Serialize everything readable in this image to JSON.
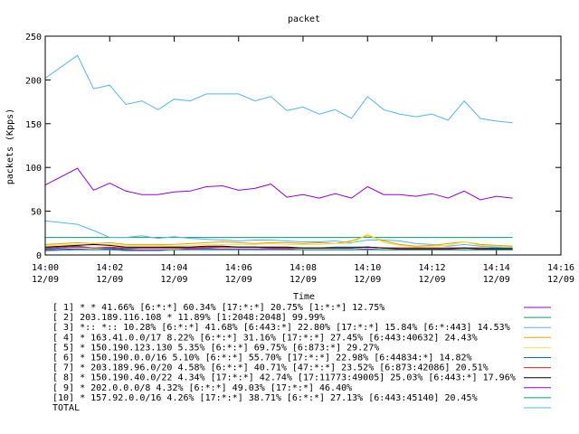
{
  "chart_data": {
    "type": "line",
    "title": "packet",
    "xlabel": "Time",
    "ylabel": "packets (Kpps)",
    "ylim": [
      0,
      250
    ],
    "xlim": [
      0,
      16
    ],
    "yticks": [
      0,
      50,
      100,
      150,
      200,
      250
    ],
    "xticks": [
      {
        "x": 0,
        "time": "14:00",
        "date": "12/09"
      },
      {
        "x": 2,
        "time": "14:02",
        "date": "12/09"
      },
      {
        "x": 4,
        "time": "14:04",
        "date": "12/09"
      },
      {
        "x": 6,
        "time": "14:06",
        "date": "12/09"
      },
      {
        "x": 8,
        "time": "14:08",
        "date": "12/09"
      },
      {
        "x": 10,
        "time": "14:10",
        "date": "12/09"
      },
      {
        "x": 12,
        "time": "14:12",
        "date": "12/09"
      },
      {
        "x": 14,
        "time": "14:14",
        "date": "12/09"
      },
      {
        "x": 16,
        "time": "14:16",
        "date": "12/09"
      }
    ],
    "grid": false,
    "legend": "bottom",
    "x": [
      0,
      1,
      1.5,
      2,
      2.5,
      3,
      3.5,
      4,
      4.5,
      5,
      5.5,
      6,
      6.5,
      7,
      7.5,
      8,
      8.5,
      9,
      9.5,
      10,
      10.5,
      11,
      11.5,
      12,
      12.5,
      13,
      13.5,
      14,
      14.5
    ],
    "series": [
      {
        "name": "[ 1] * * 41.66%  [6:*:*] 60.34% [17:*:*] 20.75% [1:*:*] 12.75%",
        "color": "#9400d3",
        "values": [
          80,
          99,
          74,
          82,
          73,
          69,
          69,
          72,
          73,
          78,
          79,
          74,
          76,
          81,
          66,
          69,
          65,
          70,
          65,
          78,
          69,
          69,
          67,
          70,
          65,
          73,
          63,
          67,
          65
        ]
      },
      {
        "name": "[ 2] 203.189.116.108 * 11.89%  [1:2048:2048] 99.99%",
        "color": "#009e73",
        "values": [
          20,
          20,
          20,
          20,
          20,
          20,
          20,
          20,
          20,
          20,
          20,
          20,
          20,
          20,
          20,
          20,
          20,
          20,
          20,
          20,
          20,
          20,
          20,
          20,
          20,
          20,
          20,
          20,
          20
        ]
      },
      {
        "name": "[ 3] *:: *:: 10.28%  [6:*:*] 41.68% [6:443:*] 22.80% [17:*:*] 15.84% [6:*:443] 14.53%",
        "color": "#56b4e9",
        "values": [
          39,
          35,
          28,
          20,
          20,
          22,
          19,
          21,
          19,
          18,
          17,
          16,
          17,
          17,
          16,
          15,
          15,
          16,
          14,
          17,
          17,
          16,
          13,
          12,
          10,
          12,
          10,
          9,
          10
        ]
      },
      {
        "name": "[ 4] * 163.41.0.0/17 8.22%  [6:*:*] 31.16% [17:*:*] 27.45% [6:443:40632] 24.43%",
        "color": "#e69f00",
        "values": [
          12,
          14,
          13,
          14,
          12,
          12,
          12,
          12,
          13,
          14,
          15,
          14,
          13,
          14,
          14,
          13,
          14,
          13,
          16,
          22,
          16,
          12,
          10,
          11,
          13,
          15,
          12,
          11,
          10
        ]
      },
      {
        "name": "[ 5] * 150.190.123.130 5.35%  [6:*:*] 69.75% [6:873:*] 29.27%",
        "color": "#f0e442",
        "values": [
          11,
          12,
          11,
          12,
          11,
          11,
          11,
          10,
          11,
          12,
          12,
          12,
          12,
          13,
          12,
          12,
          12,
          13,
          13,
          24,
          14,
          11,
          9,
          10,
          11,
          15,
          11,
          10,
          9
        ]
      },
      {
        "name": "[ 6] * 150.190.0.0/16 5.10%  [6:*:*] 55.70% [17:*:*] 22.98% [6:44834:*] 14.82%",
        "color": "#0072b2",
        "values": [
          7,
          9,
          8,
          8,
          7,
          8,
          8,
          8,
          8,
          8,
          9,
          9,
          9,
          8,
          8,
          8,
          8,
          9,
          9,
          9,
          8,
          8,
          8,
          8,
          8,
          8,
          8,
          8,
          8
        ]
      },
      {
        "name": "[ 7] * 203.189.96.0/20 4.58%  [6:*:*] 40.71% [47:*:*] 23.52% [6:873:42086] 20.51%",
        "color": "#e51e10",
        "values": [
          8,
          10,
          8,
          9,
          8,
          8,
          8,
          8,
          8,
          9,
          9,
          9,
          9,
          8,
          8,
          8,
          8,
          8,
          8,
          9,
          8,
          8,
          8,
          8,
          8,
          8,
          8,
          7,
          7
        ]
      },
      {
        "name": "[ 8] * 150.190.40.0/22 4.34%  [17:*:*] 42.74% [17:11773:49005] 25.03% [6:443:*] 17.96%",
        "color": "#000000",
        "values": [
          9,
          11,
          12,
          11,
          9,
          9,
          9,
          9,
          9,
          10,
          10,
          9,
          9,
          9,
          9,
          8,
          8,
          8,
          8,
          9,
          8,
          7,
          7,
          7,
          7,
          8,
          7,
          7,
          7
        ]
      },
      {
        "name": "[ 9] * 202.0.0.0/8 4.32%  [6:*:*] 49.03% [17:*:*] 46.40%",
        "color": "#9400d3",
        "values": [
          6,
          7,
          6,
          7,
          6,
          6,
          6,
          6,
          7,
          7,
          7,
          7,
          7,
          7,
          7,
          6,
          6,
          6,
          6,
          7,
          6,
          6,
          6,
          6,
          6,
          6,
          6,
          6,
          6
        ]
      },
      {
        "name": "[10] * 157.92.0.0/16 4.26%  [17:*:*] 38.71% [6:*:*] 27.13% [6:443:45140] 20.45%",
        "color": "#009e73",
        "values": [
          5,
          6,
          6,
          6,
          5,
          5,
          5,
          6,
          6,
          6,
          6,
          6,
          6,
          6,
          6,
          6,
          6,
          6,
          6,
          6,
          6,
          6,
          6,
          6,
          6,
          6,
          6,
          6,
          6
        ]
      },
      {
        "name": "TOTAL",
        "color": "#56b4e9",
        "values": [
          202,
          228,
          190,
          194,
          172,
          176,
          166,
          178,
          176,
          184,
          184,
          184,
          176,
          181,
          165,
          169,
          161,
          166,
          156,
          181,
          166,
          161,
          158,
          161,
          154,
          176,
          156,
          153,
          151
        ]
      }
    ]
  }
}
